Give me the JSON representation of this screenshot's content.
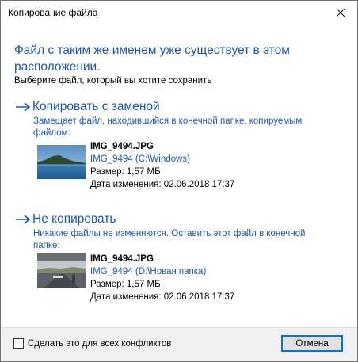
{
  "window": {
    "title": "Копирование файла"
  },
  "header": {
    "headline": "Файл с таким же именем уже существует в этом расположении.",
    "subline": "Выберите файл, который вы хотите сохранить"
  },
  "options": [
    {
      "title": "Копировать с заменой",
      "description": "Замещает файл, находившийся в конечной папке, копируемым файлом:",
      "file": {
        "name": "IMG_9494.JPG",
        "location": "IMG_9494 (C:\\Windows)",
        "size": "Размер: 1,57 МБ",
        "modified": "Дата изменения: 02.06.2018 17:37"
      }
    },
    {
      "title": "Не копировать",
      "description": "Никакие файлы не изменяются. Оставить этот файл в конечной папке:",
      "file": {
        "name": "IMG_9494.JPG",
        "location": "IMG_9494 (D:\\Новая папка)",
        "size": "Размер: 1,57 МБ",
        "modified": "Дата изменения: 02.06.2018 17:37"
      }
    }
  ],
  "footer": {
    "apply_all_label": "Сделать это для всех конфликтов",
    "cancel_label": "Отмена"
  },
  "icons": {
    "close": "close-icon",
    "arrow": "arrow-right-icon",
    "checkbox": "checkbox-unchecked"
  },
  "colors": {
    "accent_text": "#1a57b4",
    "button_focus_border": "#0078d7",
    "footer_bg": "#f0f0f0"
  }
}
